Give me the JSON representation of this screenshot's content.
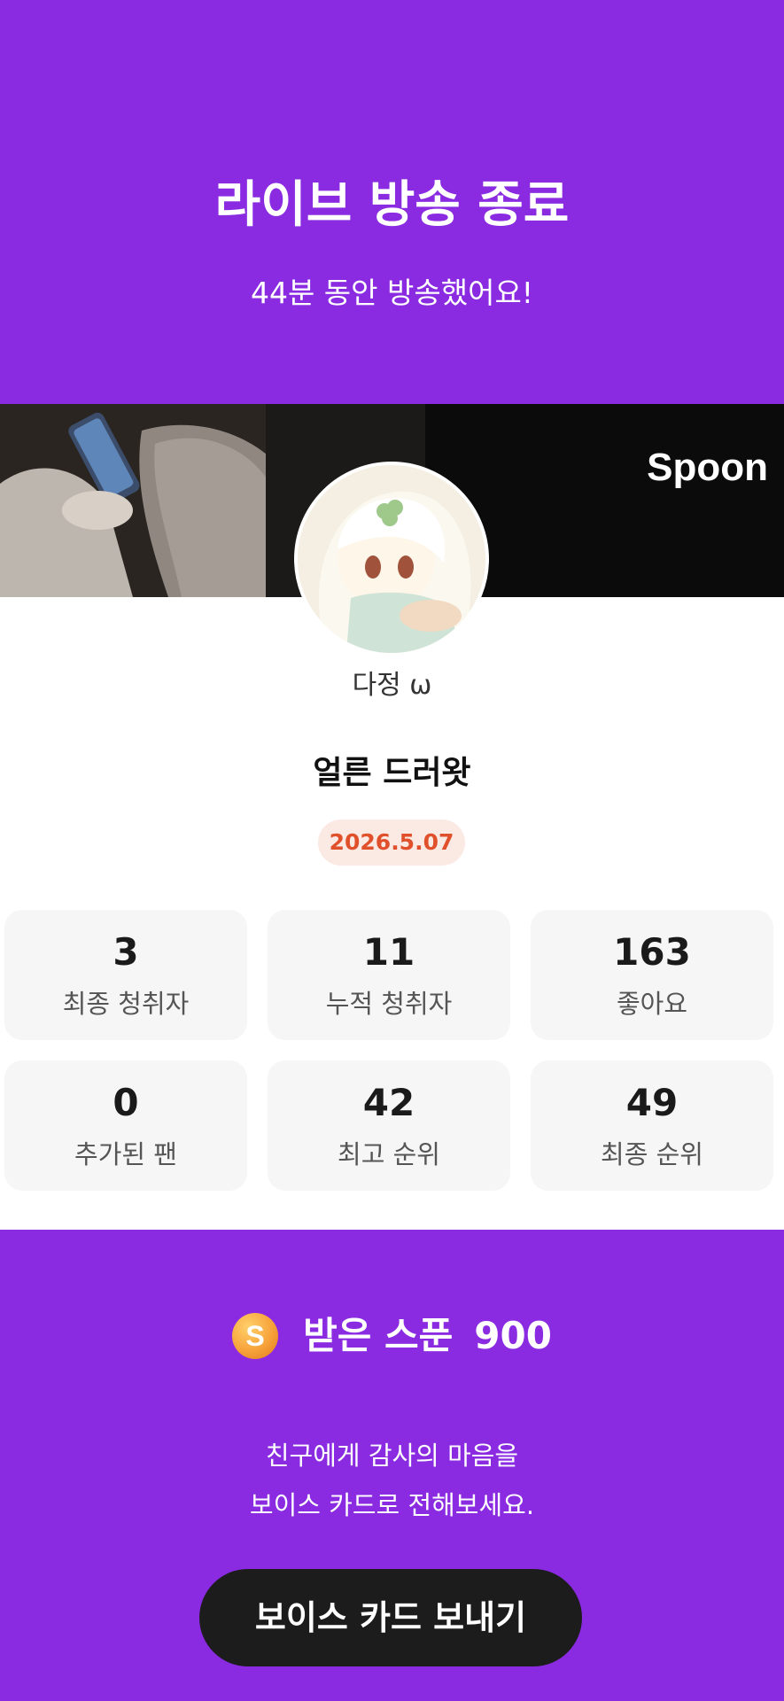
{
  "header": {
    "title": "라이브 방송 종료",
    "subtitle": "44분 동안 방송했어요!"
  },
  "banner": {
    "brand": "Spoon"
  },
  "profile": {
    "nickname": "다정 ω",
    "live_title": "얼른 드러왓",
    "date": "2026.5.07"
  },
  "stats": [
    {
      "value": "3",
      "label": "최종 청취자"
    },
    {
      "value": "11",
      "label": "누적 청취자"
    },
    {
      "value": "163",
      "label": "좋아요"
    },
    {
      "value": "0",
      "label": "추가된 팬"
    },
    {
      "value": "42",
      "label": "최고 순위"
    },
    {
      "value": "49",
      "label": "최종 순위"
    }
  ],
  "spoons": {
    "icon": "coin-icon",
    "icon_glyph": "S",
    "label": "받은 스푼",
    "count": "900"
  },
  "message": {
    "line1": "친구에게 감사의 마음을",
    "line2": "보이스 카드로 전해보세요."
  },
  "button": {
    "label": "보이스 카드 보내기"
  },
  "colors": {
    "accent": "#8a2be2",
    "date_badge_bg": "#fbe9e4",
    "date_badge_text": "#e0502a",
    "button_bg": "#1c1c1c",
    "card_bg": "#f6f6f6"
  }
}
